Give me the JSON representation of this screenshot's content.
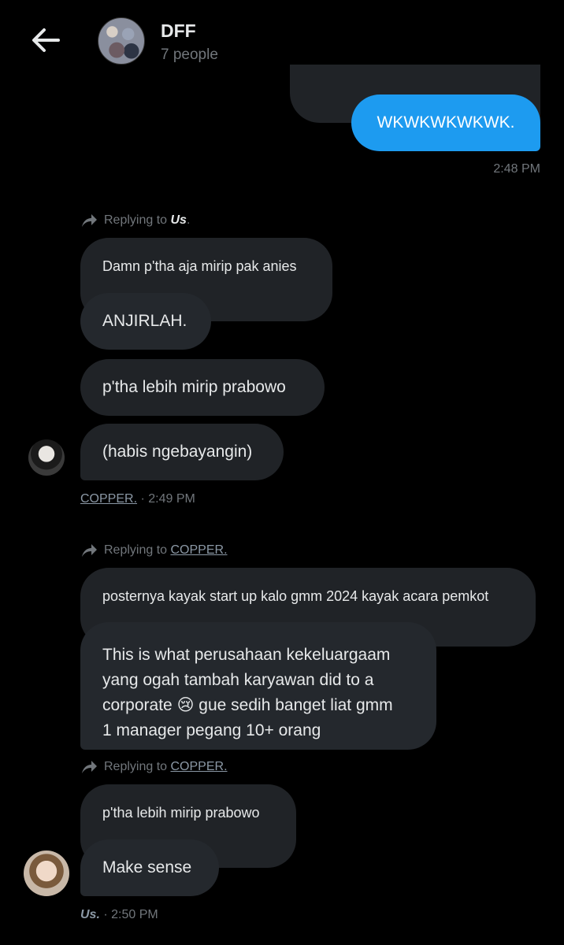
{
  "header": {
    "back_label": "Back",
    "group_name": "DFF",
    "group_members": "7 people"
  },
  "messages": {
    "sent_text": "WKWKWKWKWK.",
    "sent_time": "2:48 PM",
    "reply1_prefix": "Replying to ",
    "reply1_target": "Us",
    "reply1_suffix": ".",
    "m1": "Damn p'tha aja mirip pak anies",
    "m2": "ANJIRLAH.",
    "m3": "p'tha lebih mirip prabowo",
    "m4": "(habis ngebayangin)",
    "m4_author": "COPPER.",
    "m4_time": " · 2:49 PM",
    "reply2_prefix": "Replying to ",
    "reply2_target": "COPPER.",
    "m5": "posternya kayak start up kalo gmm 2024 kayak acara pemkot",
    "m6_line1": "This is what perusahaan kekeluargaam",
    "m6_line2": "yang ogah tambah karyawan did to a",
    "m6_line3a": "corporate ",
    "m6_emoji": "😢",
    "m6_line3b": " gue sedih banget liat gmm",
    "m6_line4": "1 manager pegang 10+ orang",
    "reply3_prefix": "Replying to ",
    "reply3_target": "COPPER.",
    "m7": "p'tha lebih mirip prabowo",
    "m8": "Make sense",
    "m8_author": "Us.",
    "m8_time": " · 2:50 PM"
  },
  "colors": {
    "background": "#000000",
    "bubble_other": "#202327",
    "bubble_mine": "#1d9bf0",
    "muted_text": "#71767b"
  },
  "icons": [
    "back-arrow-icon",
    "reply-arrow-icon"
  ]
}
